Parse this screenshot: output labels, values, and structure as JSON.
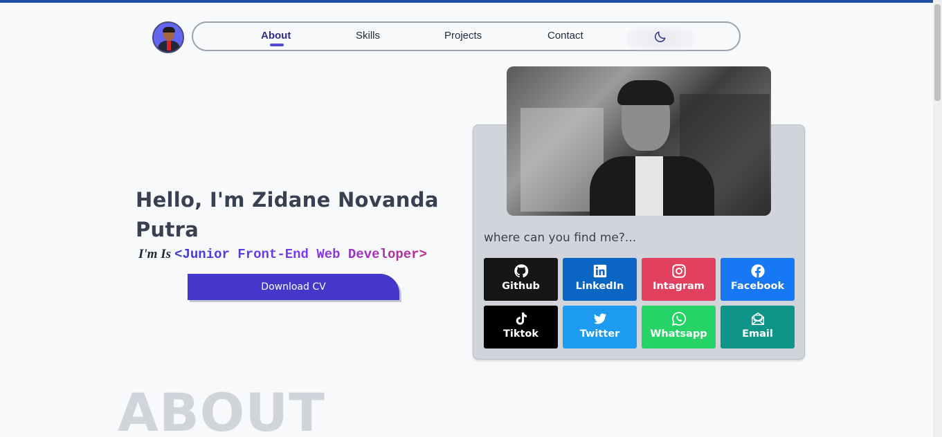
{
  "nav": {
    "items": [
      {
        "label": "About",
        "active": true
      },
      {
        "label": "Skills"
      },
      {
        "label": "Projects"
      },
      {
        "label": "Contact"
      }
    ],
    "theme_toggle_icon": "moon-icon"
  },
  "hero": {
    "title": "Hello, I'm Zidane Novanda Putra",
    "role_prefix": "I'm Is",
    "role_text": "<Junior Front-End Web Developer>",
    "download_label": "Download CV"
  },
  "card": {
    "find_me": "where can you find me?...",
    "socials": [
      {
        "label": "Github",
        "icon": "github-icon",
        "color": "#161616"
      },
      {
        "label": "LinkedIn",
        "icon": "linkedin-icon",
        "color": "#0a66c2"
      },
      {
        "label": "Intagram",
        "icon": "instagram-icon",
        "color": "#e1405e"
      },
      {
        "label": "Facebook",
        "icon": "facebook-icon",
        "color": "#1877f2"
      },
      {
        "label": "Tiktok",
        "icon": "tiktok-icon",
        "color": "#000000"
      },
      {
        "label": "Twitter",
        "icon": "twitter-icon",
        "color": "#1d9bf0"
      },
      {
        "label": "Whatsapp",
        "icon": "whatsapp-icon",
        "color": "#25d366"
      },
      {
        "label": "Email",
        "icon": "email-icon",
        "color": "#0f9488"
      }
    ]
  },
  "about": {
    "heading": "ABOUT"
  },
  "colors": {
    "accent": "#4338ca",
    "topbar": "#1e4fa0"
  }
}
